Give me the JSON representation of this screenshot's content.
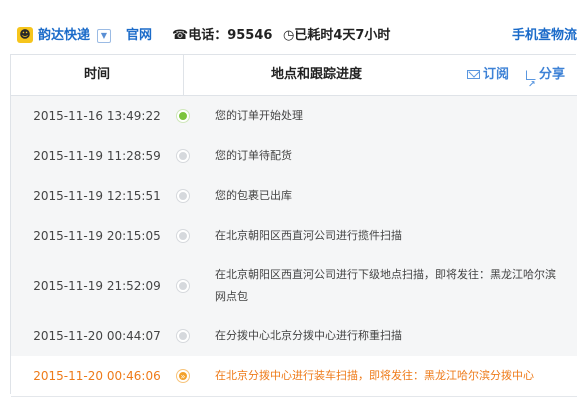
{
  "topbar": {
    "company": "韵达快递",
    "official": "官网",
    "phone": "电话：95546",
    "elapsed": "已耗时4天7小时",
    "mobile_link": "手机查物流"
  },
  "table": {
    "col_time": "时间",
    "col_progress": "地点和跟踪进度",
    "subscribe": "订阅",
    "share": "分享"
  },
  "rows": [
    {
      "time": "2015-11-16 13:49:22",
      "desc": "您的订单开始处理"
    },
    {
      "time": "2015-11-19 11:28:59",
      "desc": "您的订单待配货"
    },
    {
      "time": "2015-11-19 12:15:51",
      "desc": "您的包裹已出库"
    },
    {
      "time": "2015-11-19 20:15:05",
      "desc": "在北京朝阳区西直河公司进行揽件扫描"
    },
    {
      "time": "2015-11-19 21:52:09",
      "desc": "在北京朝阳区西直河公司进行下级地点扫描，即将发往：黑龙江哈尔滨网点包"
    },
    {
      "time": "2015-11-20 00:44:07",
      "desc": "在分拨中心北京分拨中心进行称重扫描"
    },
    {
      "time": "2015-11-20 00:46:06",
      "desc": "在北京分拨中心进行装车扫描，即将发往：黑龙江哈尔滨分拨中心"
    }
  ],
  "colors": {
    "brand_blue": "#1b6bc9",
    "highlight_orange": "#ee7b1a",
    "first_dot_green": "#7cc43c"
  }
}
